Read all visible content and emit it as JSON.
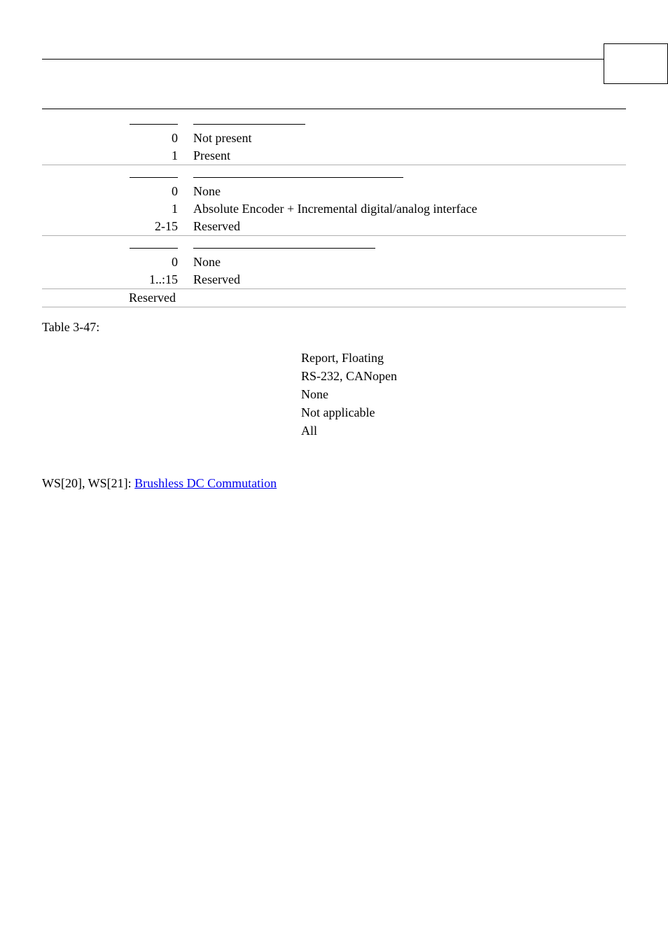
{
  "table": {
    "group1": {
      "r0": {
        "val": "0",
        "desc": "Not present"
      },
      "r1": {
        "val": "1",
        "desc": "Present"
      }
    },
    "group2": {
      "r0": {
        "val": "0",
        "desc": "None"
      },
      "r1": {
        "val": "1",
        "desc": "Absolute Encoder + Incremental digital/analog interface"
      },
      "r2": {
        "val": "2-15",
        "desc": "Reserved"
      }
    },
    "group3": {
      "r0": {
        "val": "0",
        "desc": "None"
      },
      "r1": {
        "val": "1..:15",
        "desc": "Reserved"
      }
    },
    "footer": {
      "desc": "Reserved"
    }
  },
  "caption": "Table 3-47:",
  "props": {
    "l1": "Report, Floating",
    "l2": "RS-232, CANopen",
    "l3": "None",
    "l4": "Not applicable",
    "l5": "All"
  },
  "see_also": {
    "prefix": "WS[20], WS[21]: ",
    "link": "Brushless DC Commutation"
  }
}
